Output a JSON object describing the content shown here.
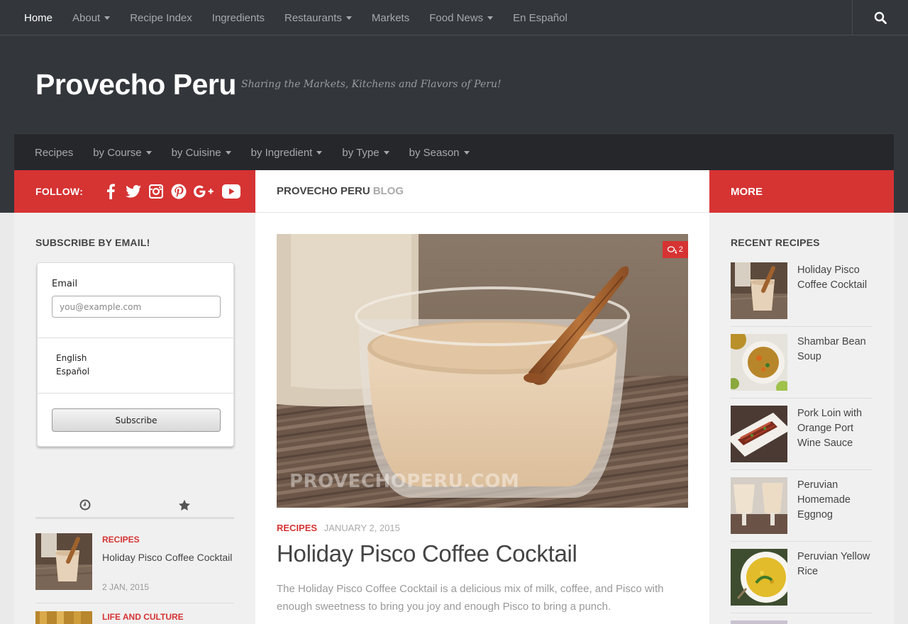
{
  "top_nav": {
    "items": [
      {
        "label": "Home",
        "dropdown": false
      },
      {
        "label": "About",
        "dropdown": true
      },
      {
        "label": "Recipe Index",
        "dropdown": false
      },
      {
        "label": "Ingredients",
        "dropdown": false
      },
      {
        "label": "Restaurants",
        "dropdown": true
      },
      {
        "label": "Markets",
        "dropdown": false
      },
      {
        "label": "Food News",
        "dropdown": true
      },
      {
        "label": "En Español",
        "dropdown": false
      }
    ]
  },
  "header": {
    "site_title": "Provecho Peru",
    "tagline": "Sharing the Markets, Kitchens and Flavors of Peru!"
  },
  "sub_nav": {
    "items": [
      {
        "label": "Recipes",
        "dropdown": false
      },
      {
        "label": "by Course",
        "dropdown": true
      },
      {
        "label": "by Cuisine",
        "dropdown": true
      },
      {
        "label": "by Ingredient",
        "dropdown": true
      },
      {
        "label": "by Type",
        "dropdown": true
      },
      {
        "label": "by Season",
        "dropdown": true
      }
    ]
  },
  "follow": {
    "label": "FOLLOW:",
    "icons": [
      "facebook-icon",
      "twitter-icon",
      "instagram-icon",
      "pinterest-icon",
      "google-plus-icon",
      "youtube-icon"
    ]
  },
  "blog_bar": {
    "part1": "PROVECHO PERU",
    "part2": "BLOG"
  },
  "more_bar": {
    "label": "MORE"
  },
  "subscribe": {
    "title": "SUBSCRIBE BY EMAIL!",
    "email_label": "Email",
    "email_placeholder": "you@example.com",
    "lang_en": "English",
    "lang_es": "Español",
    "button": "Subscribe"
  },
  "sidebar_posts": [
    {
      "category": "RECIPES",
      "title": "Holiday Pisco Coffee Cocktail",
      "date": "2 JAN, 2015"
    },
    {
      "category": "LIFE AND CULTURE",
      "title": "",
      "date": ""
    }
  ],
  "article": {
    "comment_count": "2",
    "watermark": "PROVECHOPERU.COM",
    "category": "RECIPES",
    "date": "JANUARY 2, 2015",
    "title": "Holiday Pisco Coffee Cocktail",
    "excerpt": "The Holiday Pisco Coffee Cocktail is a delicious mix of milk, coffee, and Pisco with enough sweetness to bring you joy and enough Pisco to bring a punch."
  },
  "recent_recipes": {
    "title": "RECENT RECIPES",
    "items": [
      {
        "title": "Holiday Pisco Coffee Cocktail"
      },
      {
        "title": "Shambar Bean Soup"
      },
      {
        "title": "Pork Loin with Orange Port Wine Sauce"
      },
      {
        "title": "Peruvian Homemade Eggnog"
      },
      {
        "title": "Peruvian Yellow Rice"
      }
    ]
  },
  "colors": {
    "accent": "#d63333",
    "dark": "#33363b"
  }
}
